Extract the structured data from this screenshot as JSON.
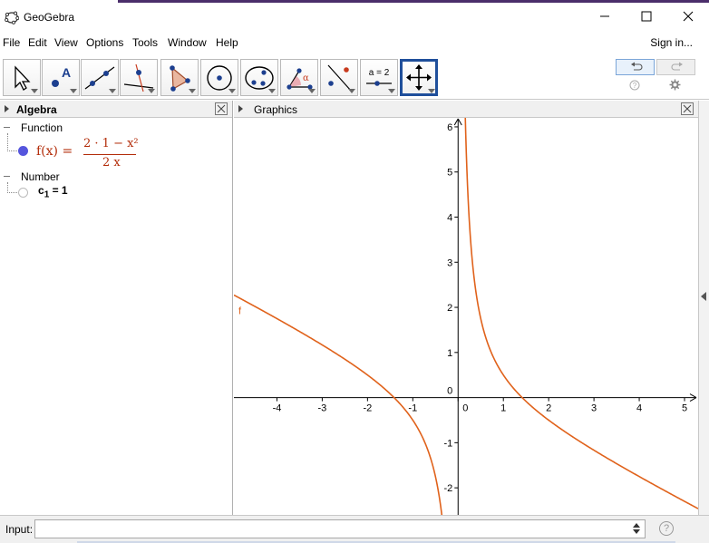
{
  "window": {
    "title": "GeoGebra",
    "app_icon": "geogebra-ellipse-icon",
    "controls": [
      "minimize-icon",
      "maximize-icon",
      "close-icon"
    ]
  },
  "menubar": {
    "items": [
      "File",
      "Edit",
      "View",
      "Options",
      "Tools",
      "Window",
      "Help"
    ],
    "sign_in": "Sign in..."
  },
  "toolbar": {
    "tools": [
      {
        "name": "move-tool",
        "icon": "arrow-cursor-icon"
      },
      {
        "name": "point-tool",
        "icon": "point-a-icon",
        "glyph": "A"
      },
      {
        "name": "line-tool",
        "icon": "line-through-points-icon"
      },
      {
        "name": "perpendicular-tool",
        "icon": "perpendicular-line-icon"
      },
      {
        "name": "polygon-tool",
        "icon": "polygon-icon"
      },
      {
        "name": "circle-tool",
        "icon": "circle-center-icon"
      },
      {
        "name": "conic-tool",
        "icon": "ellipse-icon"
      },
      {
        "name": "angle-tool",
        "icon": "angle-icon",
        "glyph": "α"
      },
      {
        "name": "reflect-tool",
        "icon": "reflect-icon"
      },
      {
        "name": "slider-tool",
        "icon": "slider-icon",
        "glyph": "a = 2"
      },
      {
        "name": "move-graphics-tool",
        "icon": "move-arrows-icon",
        "selected": true
      }
    ],
    "undo_icon": "undo-icon",
    "redo_icon": "redo-icon",
    "help_icon": "help-icon",
    "settings_icon": "gear-icon"
  },
  "algebra": {
    "title": "Algebra",
    "groups": [
      {
        "label": "Function",
        "items": [
          {
            "lhs": "f(x) =",
            "numerator": "2 · 1 − x²",
            "denominator": "2 x"
          }
        ]
      },
      {
        "label": "Number",
        "items": [
          {
            "name": "c",
            "subscript": "1",
            "value": "= 1"
          }
        ]
      }
    ]
  },
  "graphics": {
    "title": "Graphics",
    "curve_label": "f",
    "curve_color": "#e0621b"
  },
  "chart_data": {
    "type": "line",
    "title": "",
    "function": "f(x) = (2·1 − x²) / (2x)",
    "series": [
      {
        "name": "f",
        "color": "#e0621b"
      }
    ],
    "xlim": [
      -4.95,
      5.3
    ],
    "ylim": [
      -2.6,
      6.2
    ],
    "x_ticks": [
      -4,
      -3,
      -2,
      -1,
      0,
      1,
      2,
      3,
      4,
      5
    ],
    "y_ticks": [
      -2,
      -1,
      0,
      1,
      2,
      3,
      4,
      5,
      6
    ],
    "x_tick_labels": [
      "-4",
      "-3",
      "-2",
      "-1",
      "0",
      "1",
      "2",
      "3",
      "4",
      "5"
    ],
    "y_tick_labels": [
      "-2",
      "-1",
      "0",
      "1",
      "2",
      "3",
      "4",
      "5",
      "6"
    ],
    "grid": false
  },
  "input": {
    "label": "Input:",
    "value": "",
    "placeholder": "",
    "arrow_icon": "up-down-arrows-icon",
    "help_icon": "help-icon",
    "help_glyph": "?"
  }
}
